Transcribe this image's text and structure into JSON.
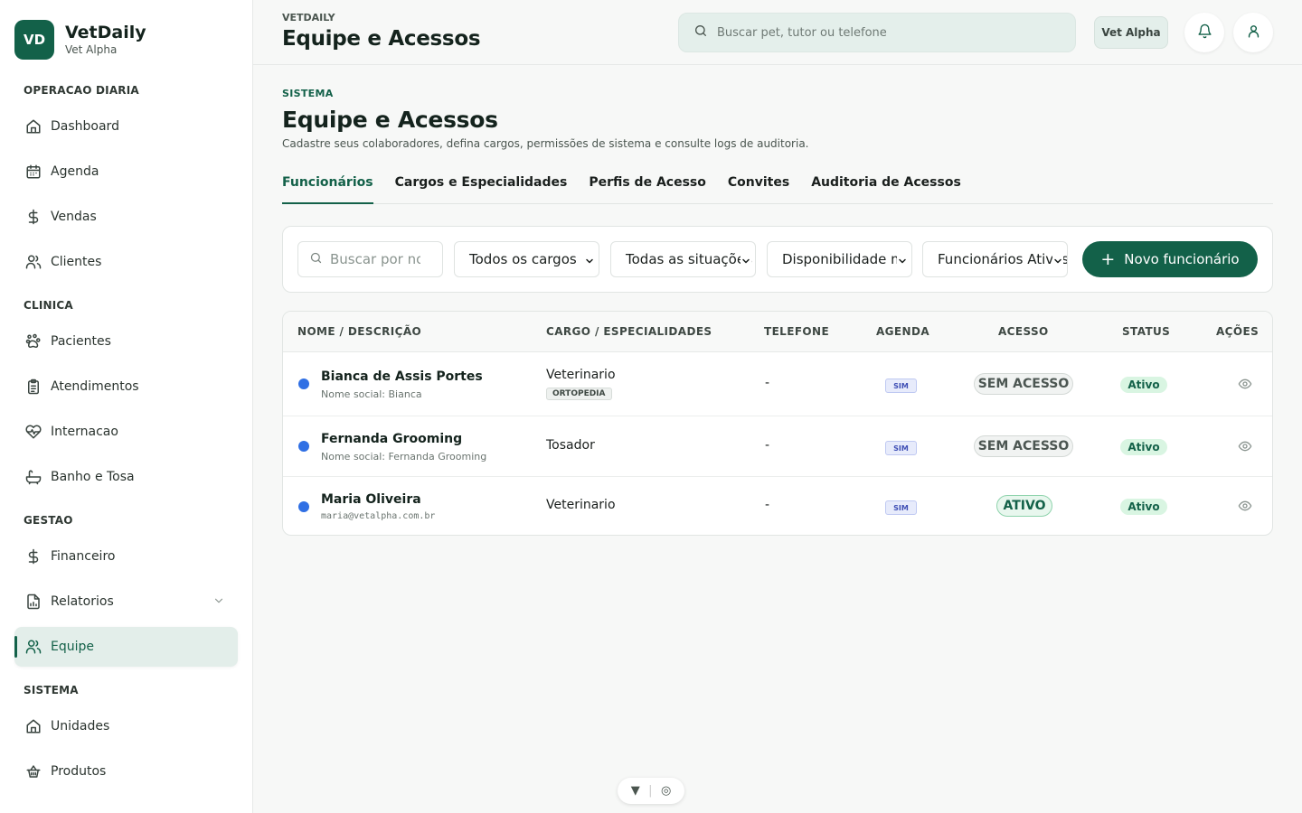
{
  "brand": {
    "logo_text": "VD",
    "name": "VetDaily",
    "subtitle": "Vet Alpha",
    "color": "#136149"
  },
  "sidebar": {
    "sections": [
      {
        "title": "OPERACAO DIARIA",
        "items": [
          {
            "label": "Dashboard",
            "icon": "home-icon"
          },
          {
            "label": "Agenda",
            "icon": "calendar-icon"
          },
          {
            "label": "Vendas",
            "icon": "dollar-icon"
          },
          {
            "label": "Clientes",
            "icon": "users-icon"
          }
        ]
      },
      {
        "title": "CLINICA",
        "items": [
          {
            "label": "Pacientes",
            "icon": "paw-icon"
          },
          {
            "label": "Atendimentos",
            "icon": "clipboard-icon"
          },
          {
            "label": "Internacao",
            "icon": "heart-pulse-icon"
          },
          {
            "label": "Banho e Tosa",
            "icon": "bath-icon"
          }
        ]
      },
      {
        "title": "GESTAO",
        "items": [
          {
            "label": "Financeiro",
            "icon": "dollar-icon"
          },
          {
            "label": "Relatorios",
            "icon": "report-icon"
          },
          {
            "label": "Equipe",
            "icon": "users-icon",
            "active": true
          }
        ]
      },
      {
        "title": "SISTEMA",
        "items": [
          {
            "label": "Unidades",
            "icon": "home-icon"
          },
          {
            "label": "Produtos",
            "icon": "basket-icon"
          }
        ]
      }
    ]
  },
  "header": {
    "kicker": "VETDAILY",
    "title": "Equipe e Acessos",
    "search_placeholder": "Buscar pet, tutor ou telefone",
    "unit_label": "Vet Alpha"
  },
  "page": {
    "kicker": "SISTEMA",
    "title": "Equipe e Acessos",
    "description": "Cadastre seus colaboradores, defina cargos, permissões de sistema e consulte logs de auditoria.",
    "tabs": [
      "Funcionários",
      "Cargos e Especialidades",
      "Perfis de Acesso",
      "Convites",
      "Auditoria de Acessos"
    ],
    "active_tab": "Funcionários"
  },
  "filters": {
    "search_placeholder": "Buscar por nome",
    "role_select": "Todos os cargos",
    "situation_select": "Todas as situações",
    "availability_select": "Disponibilidade m",
    "employees_select": "Funcionários Ativos",
    "new_button": "Novo funcionário"
  },
  "table": {
    "headers": [
      "NOME / DESCRIÇÃO",
      "CARGO / ESPECIALIDADES",
      "TELEFONE",
      "AGENDA",
      "ACESSO",
      "STATUS",
      "AÇÕES"
    ],
    "rows": [
      {
        "name": "Bianca de Assis Portes",
        "sub": "Nome social: Bianca",
        "role": "Veterinario",
        "specialty": "ORTOPEDIA",
        "phone": "-",
        "agenda": "SIM",
        "access": "SEM ACESSO",
        "status": "Ativo"
      },
      {
        "name": "Fernanda Grooming",
        "sub": "Nome social: Fernanda Grooming",
        "role": "Tosador",
        "phone": "-",
        "agenda": "SIM",
        "access": "SEM ACESSO",
        "status": "Ativo"
      },
      {
        "name": "Maria Oliveira",
        "sub": "maria@vetalpha.com.br",
        "role": "Veterinario",
        "phone": "-",
        "agenda": "SIM",
        "access": "ATIVO",
        "status": "Ativo"
      }
    ]
  }
}
